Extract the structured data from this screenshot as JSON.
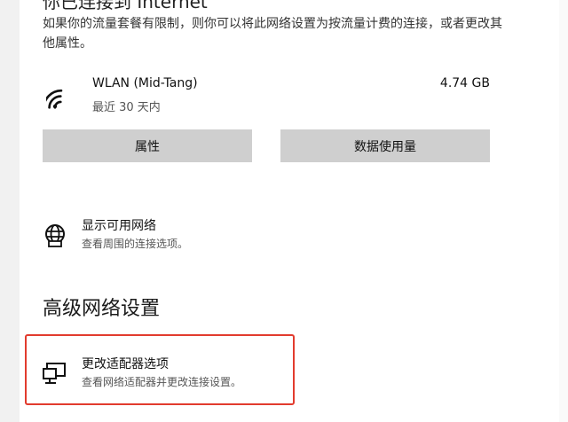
{
  "status": {
    "heading": "你已连接到 Internet",
    "description": "如果你的流量套餐有限制，则你可以将此网络设置为按流量计费的连接，或者更改其他属性。"
  },
  "connection": {
    "name": "WLAN (Mid-Tang)",
    "period": "最近 30 天内",
    "usage": "4.74 GB",
    "icon": "wifi-icon"
  },
  "buttons": {
    "properties": "属性",
    "data_usage": "数据使用量"
  },
  "available_networks": {
    "title": "显示可用网络",
    "subtitle": "查看周围的连接选项。",
    "icon": "globe-icon"
  },
  "advanced": {
    "section_title": "高级网络设置",
    "adapter_title": "更改适配器选项",
    "adapter_subtitle": "查看网络适配器并更改连接设置。",
    "icon": "monitor-icon",
    "highlight_color": "#e23b2e"
  }
}
